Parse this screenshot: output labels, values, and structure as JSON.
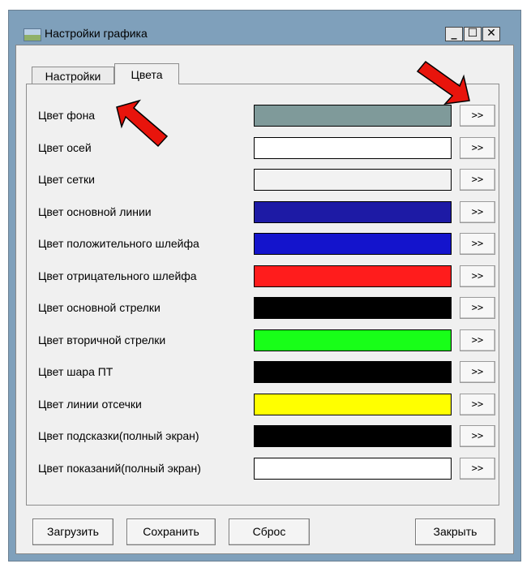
{
  "window": {
    "title": "Настройки графика",
    "controls": {
      "minimize": "_",
      "maximize": "☐",
      "close": "✕"
    }
  },
  "tabs": [
    {
      "label": "Настройки",
      "active": false
    },
    {
      "label": "Цвета",
      "active": true
    }
  ],
  "colors": {
    "pick_label": ">>",
    "rows": [
      {
        "label": "Цвет фона",
        "color": "#7f9a9a"
      },
      {
        "label": "Цвет осей",
        "color": "#ffffff"
      },
      {
        "label": "Цвет сетки",
        "color": "#f2f2f2"
      },
      {
        "label": "Цвет основной линии",
        "color": "#1d1aa5"
      },
      {
        "label": "Цвет положительного шлейфа",
        "color": "#1414cc"
      },
      {
        "label": "Цвет отрицательного шлейфа",
        "color": "#ff1c1c"
      },
      {
        "label": "Цвет основной стрелки",
        "color": "#000000"
      },
      {
        "label": "Цвет вторичной стрелки",
        "color": "#18ff18"
      },
      {
        "label": "Цвет шара ПТ",
        "color": "#000000"
      },
      {
        "label": "Цвет линии отсечки",
        "color": "#ffff00"
      },
      {
        "label": "Цвет подсказки(полный экран)",
        "color": "#000000"
      },
      {
        "label": "Цвет показаний(полный экран)",
        "color": "#ffffff"
      }
    ]
  },
  "buttons": {
    "load": "Загрузить",
    "save": "Сохранить",
    "reset": "Сброс",
    "close": "Закрыть"
  },
  "annotation_color": "#e8140c"
}
